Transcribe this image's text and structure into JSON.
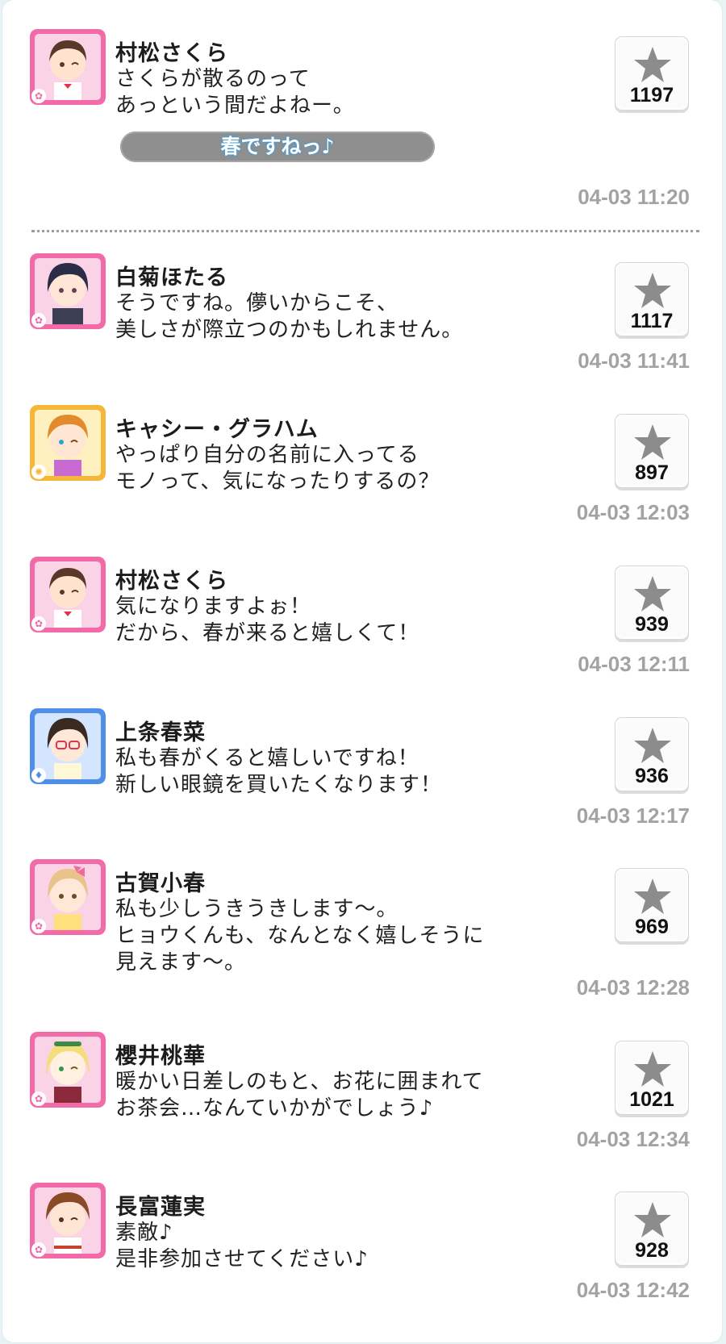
{
  "colors": {
    "cute_frame": "#f26aa8",
    "cool_frame": "#4f8fe8",
    "passion_frame": "#f5b63a",
    "star": "#8c8c8c",
    "timestamp": "#a3a3a3"
  },
  "thread": {
    "root": {
      "name": "村松さくら",
      "lines": [
        "さくらが散るのって",
        "あっという間だよねー。"
      ],
      "likes": "1197",
      "time": "04-03 11:20",
      "reply_button": "春ですねっ♪",
      "attribute": "cute",
      "avatar_icon": "character-avatar-sakura"
    },
    "replies": [
      {
        "name": "白菊ほたる",
        "lines": [
          "そうですね。儚いからこそ、",
          "美しさが際立つのかもしれません。"
        ],
        "likes": "1117",
        "time": "04-03 11:41",
        "attribute": "cute"
      },
      {
        "name": "キャシー・グラハム",
        "lines": [
          "やっぱり自分の名前に入ってる",
          "モノって、気になったりするの？"
        ],
        "likes": "897",
        "time": "04-03 12:03",
        "attribute": "passion"
      },
      {
        "name": "村松さくら",
        "lines": [
          "気になりますよぉ！",
          "だから、春が来ると嬉しくて！"
        ],
        "likes": "939",
        "time": "04-03 12:11",
        "attribute": "cute"
      },
      {
        "name": "上条春菜",
        "lines": [
          "私も春がくると嬉しいですね！",
          "新しい眼鏡を買いたくなります！"
        ],
        "likes": "936",
        "time": "04-03 12:17",
        "attribute": "cool"
      },
      {
        "name": "古賀小春",
        "lines": [
          "私も少しうきうきします〜。",
          "ヒョウくんも、なんとなく嬉しそうに",
          "見えます〜。"
        ],
        "likes": "969",
        "time": "04-03 12:28",
        "attribute": "cute"
      },
      {
        "name": "櫻井桃華",
        "lines": [
          "暖かい日差しのもと、お花に囲まれて",
          "お茶会…なんていかがでしょう♪"
        ],
        "likes": "1021",
        "time": "04-03 12:34",
        "attribute": "cute"
      },
      {
        "name": "長富蓮実",
        "lines": [
          "素敵♪",
          "是非参加させてください♪"
        ],
        "likes": "928",
        "time": "04-03 12:42",
        "attribute": "cute"
      }
    ]
  }
}
